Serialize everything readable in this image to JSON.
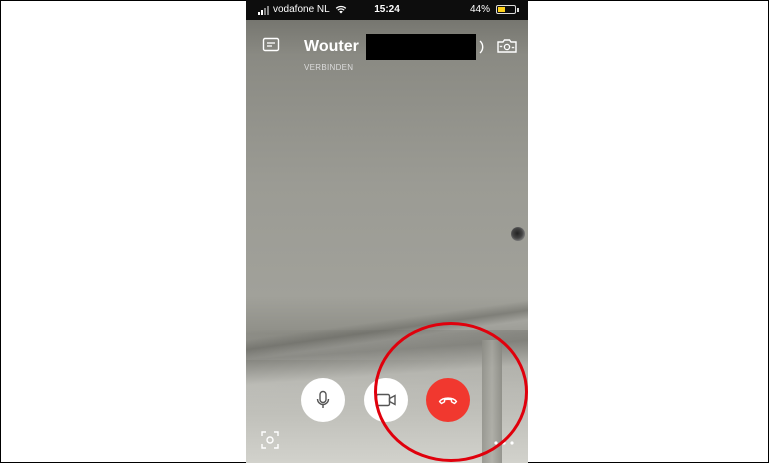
{
  "status_bar": {
    "carrier": "vodafone NL",
    "time": "15:24",
    "battery": "44%",
    "battery_level": 0.44,
    "battery_color": "#ffd21c"
  },
  "call": {
    "caller_name": "Wouter",
    "status": "VERBINDEN"
  },
  "icons": {
    "chat": "chat-icon",
    "speaker": "speaker-icon",
    "switch_camera": "switch-camera-icon",
    "microphone": "microphone-icon",
    "video": "video-camera-icon",
    "hangup": "phone-hangup-icon",
    "snapshot": "snapshot-icon",
    "more": "more-dots-icon"
  },
  "colors": {
    "hangup": "#f1382f",
    "annotation": "#e0000c"
  }
}
